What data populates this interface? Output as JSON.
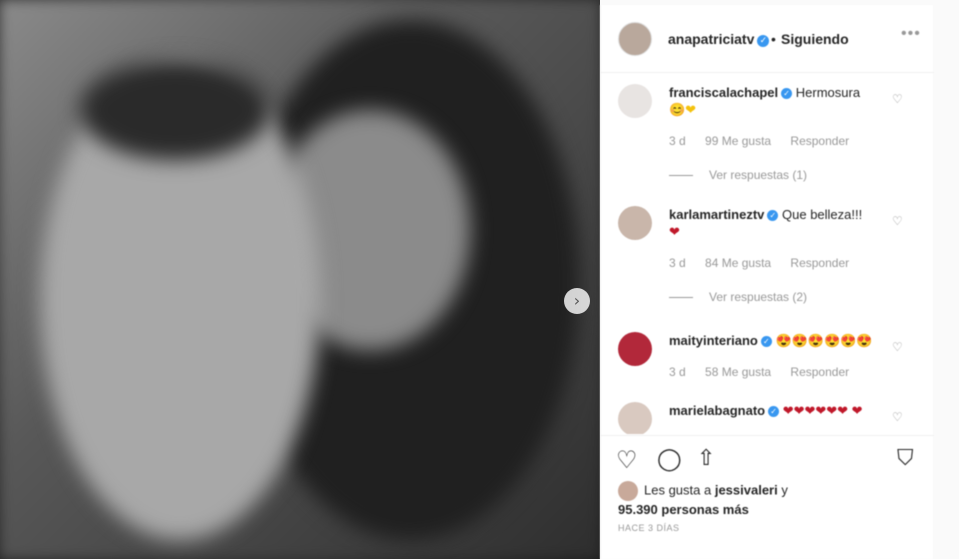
{
  "post": {
    "username": "anapatriciatv",
    "follow_status": "Siguiendo",
    "dot": "•",
    "more": "•••",
    "next_arrow": "›",
    "icons": {
      "more": "more-options-icon",
      "next": "chevron-right-icon",
      "like": "heart-outline-icon",
      "comment": "comment-icon",
      "share": "share-icon",
      "save": "bookmark-icon",
      "verified": "verified-badge-icon"
    }
  },
  "comments": [
    {
      "user": "franciscalachapel",
      "text": "Hermosura",
      "emoji": "😊❤",
      "age": "3 d",
      "likes": "99 Me gusta",
      "reply": "Responder",
      "replies": "Ver respuestas (1)",
      "avatar_color": "#e8e4e2"
    },
    {
      "user": "karlamartineztv",
      "text": "Que belleza!!!",
      "emoji": "❤",
      "age": "3 d",
      "likes": "84 Me gusta",
      "reply": "Responder",
      "replies": "Ver respuestas (2)",
      "avatar_color": "#c9b6aa"
    },
    {
      "user": "maityinteriano",
      "text": "",
      "emoji": "😍😍😍😍😍😍",
      "age": "3 d",
      "likes": "58 Me gusta",
      "reply": "Responder",
      "replies": "",
      "avatar_color": "#b2283a"
    },
    {
      "user": "marielabagnato",
      "text": "",
      "emoji": "❤❤❤❤❤❤ ❤",
      "age": "",
      "likes": "",
      "reply": "",
      "replies": "",
      "avatar_color": "#d9c9c0"
    }
  ],
  "likes": {
    "prefix": "Les gusta a",
    "user": "jessivaleri",
    "suffix": "y",
    "count": "95.390 personas más"
  },
  "time": "HACE 3 DÍAS",
  "colors": {
    "verified": "#3897f0",
    "border": "#efefef",
    "muted": "#999999"
  }
}
